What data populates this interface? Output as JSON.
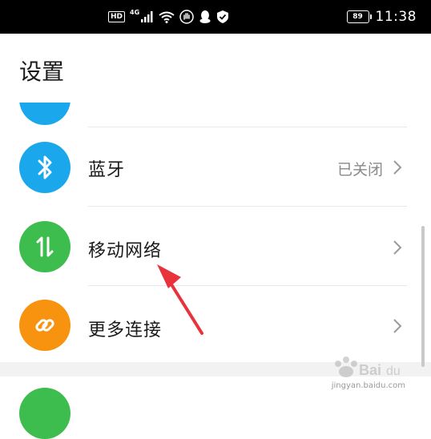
{
  "status_bar": {
    "hd_label": "HD",
    "network_label": "4G",
    "battery_level": "89",
    "time": "11:38"
  },
  "page": {
    "title": "设置"
  },
  "settings_items": [
    {
      "label": "蓝牙",
      "value": "已关闭",
      "icon": "bluetooth-icon",
      "icon_color": "#1aa7ec"
    },
    {
      "label": "移动网络",
      "value": "",
      "icon": "mobile-data-icon",
      "icon_color": "#3dbd4d"
    },
    {
      "label": "更多连接",
      "value": "",
      "icon": "link-icon",
      "icon_color": "#f7930e"
    }
  ],
  "colors": {
    "top_partial_icon": "#1aa7ec",
    "bottom_partial_icon": "#3dbd4d",
    "annotation_arrow": "#e8323c"
  },
  "watermark": {
    "text": "jingyan.baidu.com"
  }
}
